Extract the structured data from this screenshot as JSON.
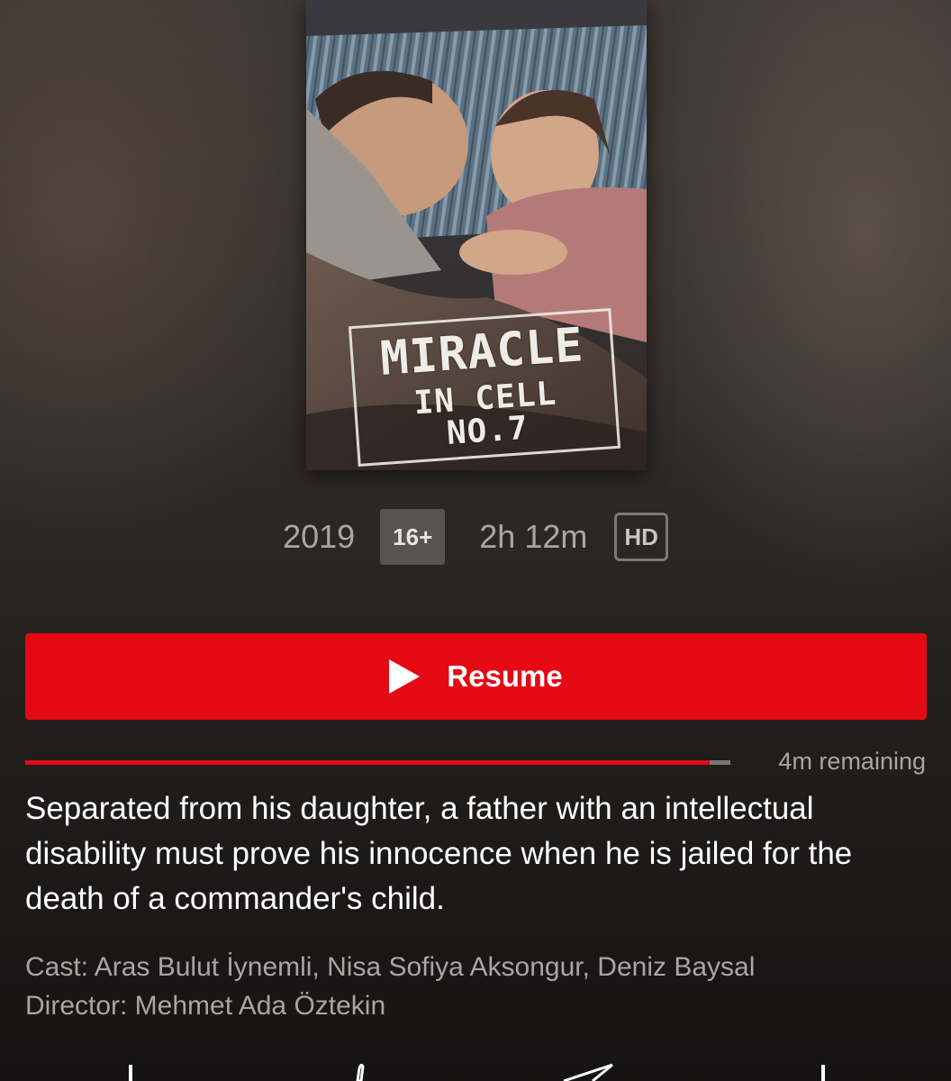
{
  "poster": {
    "title_line1": "MIRACLE",
    "title_line2": "IN CELL NO.7"
  },
  "meta": {
    "year": "2019",
    "maturity_rating": "16+",
    "duration": "2h 12m",
    "quality_badge": "HD"
  },
  "play_button": {
    "label": "Resume",
    "icon": "play-icon"
  },
  "progress": {
    "watched_fraction": 0.97,
    "remaining_label": "4m remaining"
  },
  "description": "Separated from his daughter, a father with an intellectual disability must prove his innocence when he is jailed for the death of a commander's child.",
  "credits": {
    "cast": "Cast: Aras Bulut İynemli, Nisa Sofiya Aksongur, Deniz Baysal",
    "director": "Director: Mehmet Ada Öztekin"
  },
  "actions": {
    "icons": [
      "add-icon",
      "thumbs-up-icon",
      "share-icon",
      "download-icon"
    ]
  },
  "colors": {
    "accent_red": "#e50914",
    "background": "#2b2624",
    "muted_text": "#a8a6a4"
  }
}
